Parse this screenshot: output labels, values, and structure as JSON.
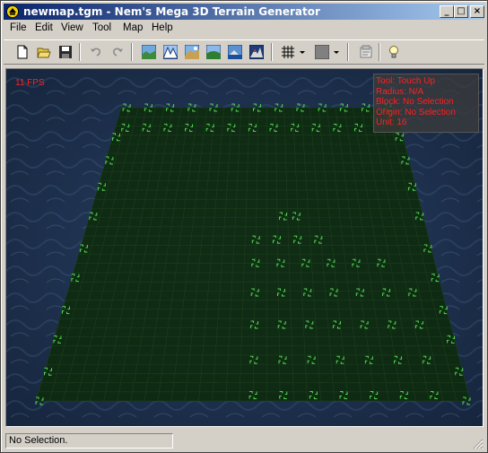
{
  "window": {
    "title": "newmap.tgm - Nem's Mega 3D Terrain Generator",
    "controls": [
      "minimize",
      "maximize",
      "close"
    ]
  },
  "menu": {
    "items": [
      {
        "label": "File"
      },
      {
        "label": "Edit"
      },
      {
        "label": "View"
      },
      {
        "label": "Tool"
      },
      {
        "label": "Map"
      },
      {
        "label": "Help"
      }
    ]
  },
  "toolbar": {
    "buttons": [
      {
        "icon": "new-file-icon"
      },
      {
        "icon": "open-folder-icon"
      },
      {
        "icon": "save-disk-icon"
      },
      {
        "icon": "undo-icon",
        "disabled": true
      },
      {
        "icon": "redo-icon",
        "disabled": true
      },
      {
        "icon": "terrain-preset-1-icon"
      },
      {
        "icon": "terrain-preset-2-icon"
      },
      {
        "icon": "terrain-preset-3-icon"
      },
      {
        "icon": "terrain-preset-4-icon"
      },
      {
        "icon": "terrain-preset-5-icon"
      },
      {
        "icon": "terrain-preset-6-icon"
      },
      {
        "icon": "grid-icon"
      },
      {
        "icon": "color-swatch-icon"
      },
      {
        "icon": "properties-icon"
      },
      {
        "icon": "lightbulb-icon"
      }
    ]
  },
  "viewport": {
    "fps": "11 FPS",
    "info": {
      "tool": "Tool: Touch Up",
      "radius": "Radius: N/A",
      "block": "Block: No Selection",
      "origin": "Origin: No Selection",
      "unit": "Unit: 16"
    }
  },
  "status": {
    "text": "No Selection."
  },
  "colors": {
    "title_active": "#0a246a",
    "title_gradient_end": "#a6caf0",
    "chrome": "#d4d0c8",
    "overlay_text": "#ff2020",
    "grid_plane": "#0e2a0e",
    "grid_lines": "#1c3f1c",
    "markers": "#4fd84f",
    "water": "#1f3048"
  }
}
